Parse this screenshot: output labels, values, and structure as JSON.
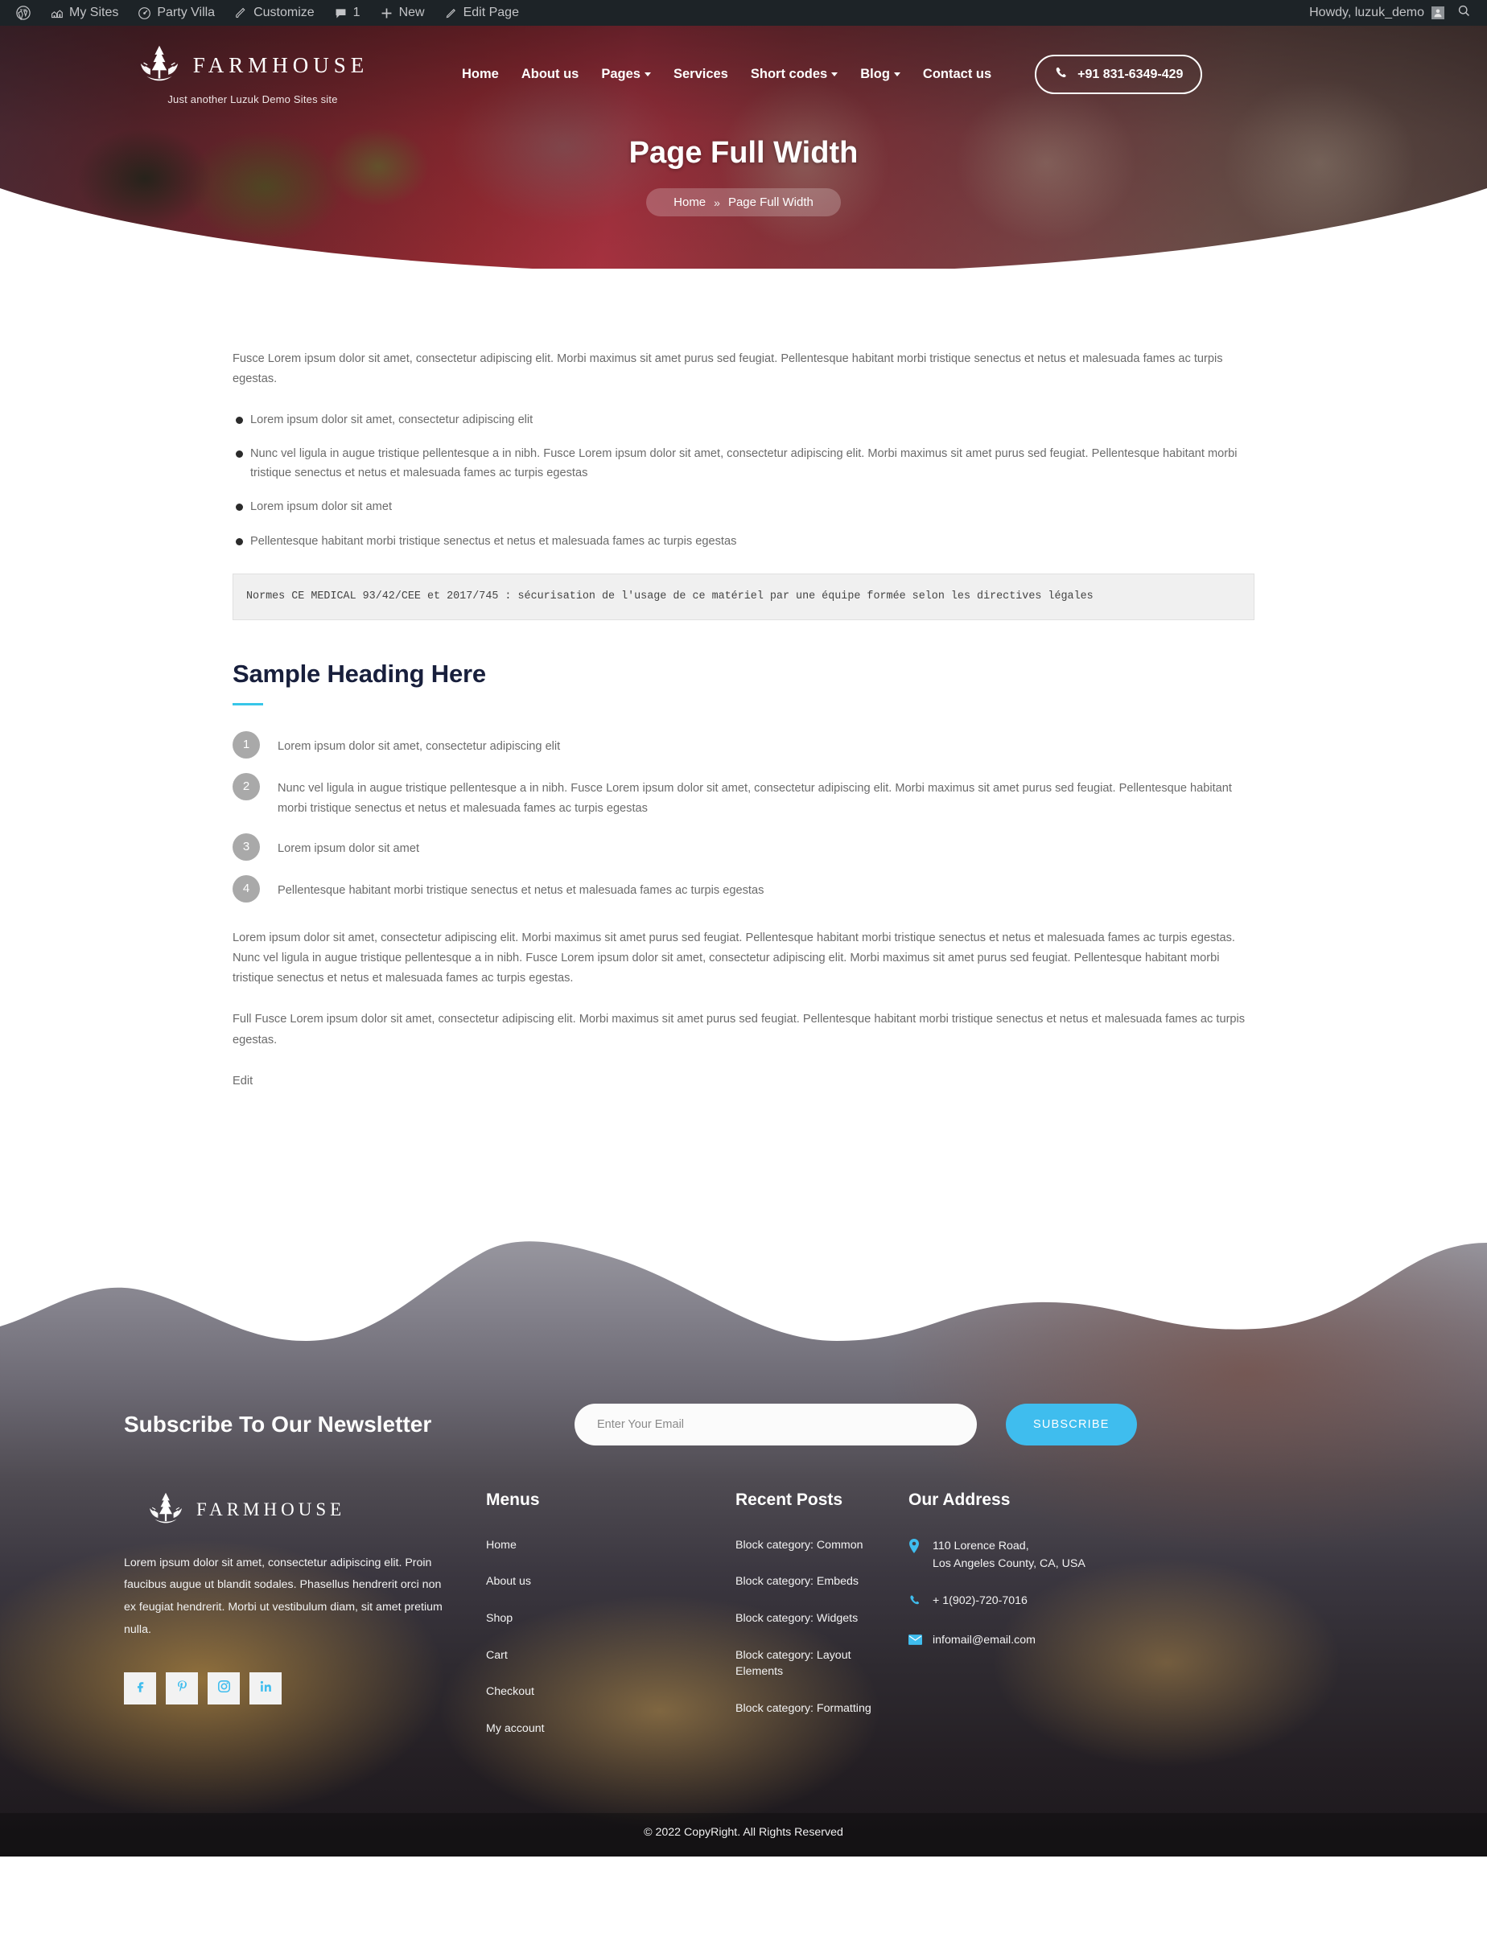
{
  "adminbar": {
    "items": [
      {
        "icon": "wordpress-icon",
        "label": ""
      },
      {
        "icon": "mysites-icon",
        "label": "My Sites"
      },
      {
        "icon": "dashboard-icon",
        "label": "Party Villa"
      },
      {
        "icon": "brush-icon",
        "label": "Customize"
      },
      {
        "icon": "comment-icon",
        "label": "1"
      },
      {
        "icon": "plus-icon",
        "label": "New"
      },
      {
        "icon": "pencil-icon",
        "label": "Edit Page"
      }
    ],
    "howdy": "Howdy, luzuk_demo",
    "search_icon": "search-icon"
  },
  "header": {
    "brand_name": "FARMHOUSE",
    "tagline": "Just another Luzuk Demo Sites site",
    "nav": [
      {
        "label": "Home",
        "dropdown": false
      },
      {
        "label": "About us",
        "dropdown": false
      },
      {
        "label": "Pages",
        "dropdown": true
      },
      {
        "label": "Services",
        "dropdown": false
      },
      {
        "label": "Short codes",
        "dropdown": true
      },
      {
        "label": "Blog",
        "dropdown": true
      },
      {
        "label": "Contact us",
        "dropdown": false
      }
    ],
    "phone": "+91 831-6349-429"
  },
  "hero": {
    "title": "Page Full Width",
    "breadcrumb_home": "Home",
    "breadcrumb_sep": "»",
    "breadcrumb_current": "Page Full Width"
  },
  "content": {
    "intro": "Fusce Lorem ipsum dolor sit amet, consectetur adipiscing elit. Morbi maximus sit amet purus sed feugiat. Pellentesque habitant morbi tristique senectus et netus et malesuada fames ac turpis egestas.",
    "bullets": [
      "Lorem ipsum dolor sit amet, consectetur adipiscing elit",
      "Nunc vel ligula in augue tristique pellentesque a in nibh. Fusce Lorem ipsum dolor sit amet, consectetur adipiscing elit. Morbi maximus sit amet purus sed feugiat. Pellentesque habitant morbi tristique senectus et netus et malesuada fames ac turpis egestas",
      "Lorem ipsum dolor sit amet",
      "Pellentesque habitant morbi tristique senectus et netus et malesuada fames ac turpis egestas"
    ],
    "codeblock": "Normes CE MEDICAL 93/42/CEE et 2017/745 : sécurisation de l'usage de ce matériel par une équipe formée selon les directives légales",
    "heading": "Sample Heading Here",
    "numbered": [
      {
        "num": "1",
        "text": "Lorem ipsum dolor sit amet, consectetur adipiscing elit"
      },
      {
        "num": "2",
        "text": "Nunc vel ligula in augue tristique pellentesque a in nibh. Fusce Lorem ipsum dolor sit amet, consectetur adipiscing elit. Morbi maximus sit amet purus sed feugiat. Pellentesque habitant morbi tristique senectus et netus et malesuada fames ac turpis egestas"
      },
      {
        "num": "3",
        "text": "Lorem ipsum dolor sit amet"
      },
      {
        "num": "4",
        "text": "Pellentesque habitant morbi tristique senectus et netus et malesuada fames ac turpis egestas"
      }
    ],
    "para_long": "Lorem ipsum dolor sit amet, consectetur adipiscing elit. Morbi maximus sit amet purus sed feugiat. Pellentesque habitant morbi tristique senectus et netus et malesuada fames ac turpis egestas. Nunc vel ligula in augue tristique pellentesque a in nibh. Fusce Lorem ipsum dolor sit amet, consectetur adipiscing elit. Morbi maximus sit amet purus sed feugiat. Pellentesque habitant morbi tristique senectus et netus et malesuada fames ac turpis egestas.",
    "para_full": "Full Fusce Lorem ipsum dolor sit amet, consectetur adipiscing elit. Morbi maximus sit amet purus sed feugiat. Pellentesque habitant morbi tristique senectus et netus et malesuada fames ac turpis egestas.",
    "edit_label": "Edit"
  },
  "newsletter": {
    "title": "Subscribe To Our Newsletter",
    "placeholder": "Enter Your Email",
    "value": "",
    "button": "SUBSCRIBE"
  },
  "footer": {
    "brand_name": "FARMHOUSE",
    "about": "Lorem ipsum dolor sit amet, consectetur adipiscing elit. Proin faucibus augue ut blandit sodales. Phasellus hendrerit orci non ex feugiat hendrerit. Morbi ut vestibulum diam, sit amet pretium nulla.",
    "socials": [
      "facebook-icon",
      "pinterest-icon",
      "instagram-icon",
      "linkedin-icon"
    ],
    "menus_title": "Menus",
    "menus": [
      "Home",
      "About us",
      "Shop",
      "Cart",
      "Checkout",
      "My account"
    ],
    "recent_title": "Recent Posts",
    "recent": [
      "Block category: Common",
      "Block category: Embeds",
      "Block category: Widgets",
      "Block category: Layout Elements",
      "Block category: Formatting"
    ],
    "address_title": "Our Address",
    "address_line1": "110 Lorence Road,",
    "address_line2": "Los Angeles County, CA, USA",
    "phone": "+ 1(902)-720-7016",
    "email": "infomail@email.com",
    "copyright": "© 2022 CopyRight. All Rights Reserved"
  },
  "colors": {
    "accent": "#3fbdee",
    "heading_navy": "#181f3c",
    "adminbar_bg": "#1d2327"
  }
}
